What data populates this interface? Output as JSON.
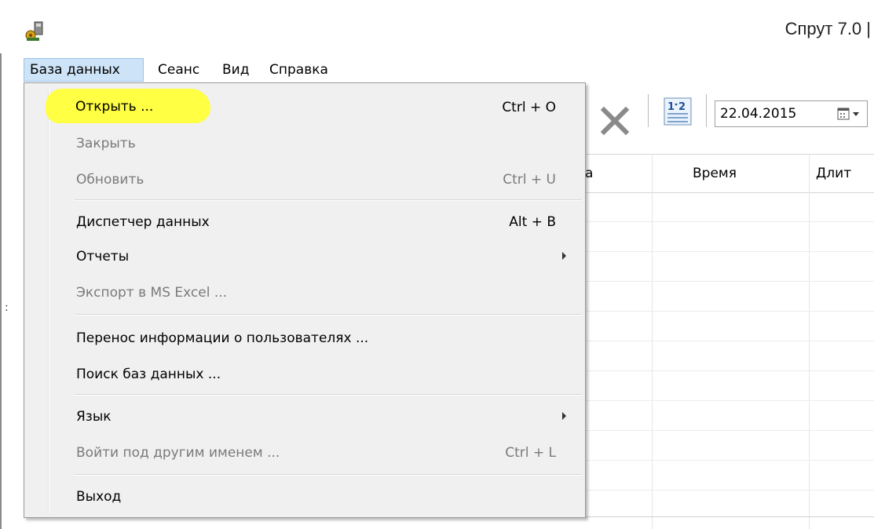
{
  "window": {
    "title": "Спрут 7.0 |"
  },
  "menubar": {
    "items": [
      "База данных",
      "Сеанс",
      "Вид",
      "Справка"
    ]
  },
  "toolbar": {
    "date": "22.04.2015"
  },
  "grid": {
    "columns": [
      "а",
      "Время",
      "Длит"
    ]
  },
  "dropdown": {
    "items": [
      {
        "label": "Открыть ...",
        "shortcut": "Ctrl + O",
        "disabled": false,
        "submenu": false
      },
      {
        "label": "Закрыть",
        "shortcut": "",
        "disabled": true,
        "submenu": false
      },
      {
        "label": "Обновить",
        "shortcut": "Ctrl + U",
        "disabled": true,
        "submenu": false
      },
      {
        "label": "Диспетчер данных",
        "shortcut": "Alt + B",
        "disabled": false,
        "submenu": false
      },
      {
        "label": "Отчеты",
        "shortcut": "",
        "disabled": false,
        "submenu": true
      },
      {
        "label": "Экспорт в MS Excel ...",
        "shortcut": "",
        "disabled": true,
        "submenu": false
      },
      {
        "label": "Перенос информации о пользователях ...",
        "shortcut": "",
        "disabled": false,
        "submenu": false
      },
      {
        "label": "Поиск баз данных ...",
        "shortcut": "",
        "disabled": false,
        "submenu": false
      },
      {
        "label": "Язык",
        "shortcut": "",
        "disabled": false,
        "submenu": true
      },
      {
        "label": "Войти под другим именем ...",
        "shortcut": "Ctrl + L",
        "disabled": true,
        "submenu": false
      },
      {
        "label": "Выход",
        "shortcut": "",
        "disabled": false,
        "submenu": false
      }
    ]
  },
  "colors": {
    "highlight": "#ffff3a",
    "menu_active": "#cde3f7",
    "menu_bg": "#f0f0f0",
    "disabled_text": "#7a7a7a"
  },
  "icons": {
    "app": "app-icon",
    "delete": "close-x-icon",
    "numbering": "numbering-icon",
    "calendar": "calendar-dropdown-icon"
  }
}
